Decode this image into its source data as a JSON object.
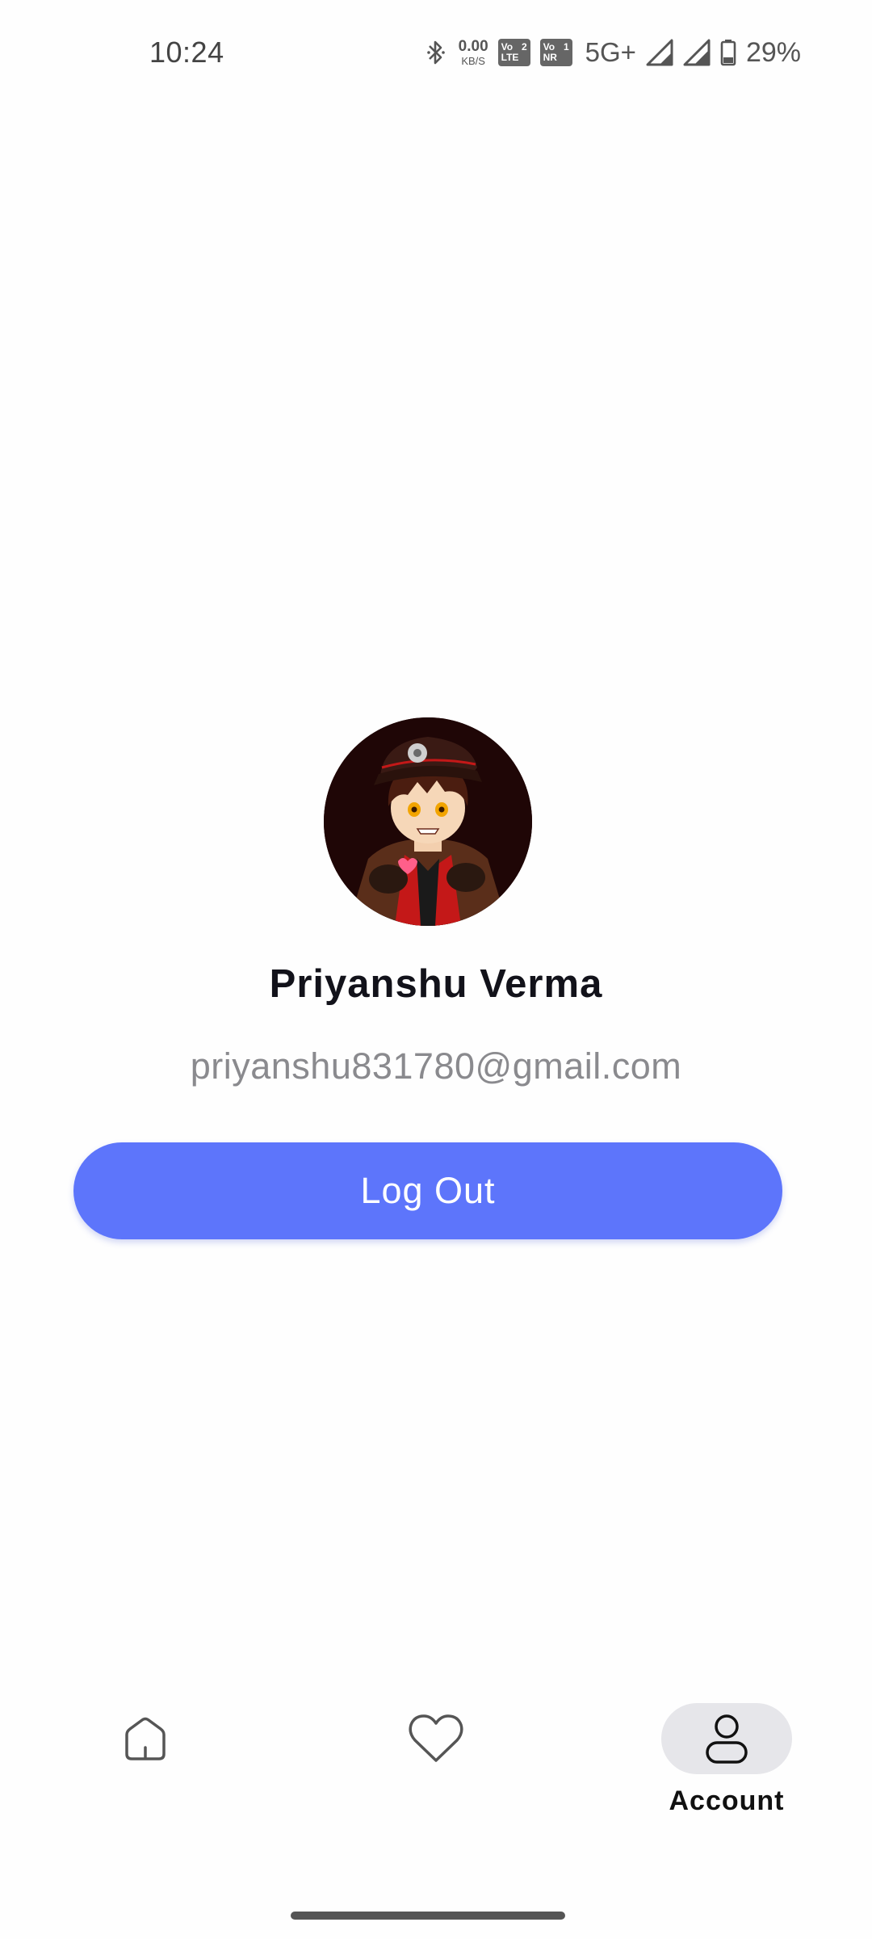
{
  "status_bar": {
    "time": "10:24",
    "net_speed_value": "0.00",
    "net_speed_unit": "KB/S",
    "sim1_top_left": "Vo",
    "sim1_top_right": "2",
    "sim1_bottom": "LTE",
    "sim2_top_left": "Vo",
    "sim2_top_right": "1",
    "sim2_bottom": "NR",
    "network_type": "5G+",
    "battery_percent": "29%",
    "icons": [
      "bluetooth-icon",
      "signal-icon",
      "signal-icon",
      "battery-icon"
    ]
  },
  "profile": {
    "name": "Priyanshu Verma",
    "email": "priyanshu831780@gmail.com",
    "avatar_icon": "avatar-anime-character"
  },
  "actions": {
    "logout_label": "Log Out"
  },
  "bottom_nav": {
    "items": [
      {
        "icon": "home-icon",
        "label": "",
        "selected": false
      },
      {
        "icon": "heart-icon",
        "label": "",
        "selected": false
      },
      {
        "icon": "person-icon",
        "label": "Account",
        "selected": true
      }
    ]
  },
  "colors": {
    "primary": "#5d75fb",
    "background": "#fefefe",
    "selected_nav_pill": "#e6e6ea",
    "email_text": "#8a8a8e",
    "name_text": "#12121a"
  }
}
